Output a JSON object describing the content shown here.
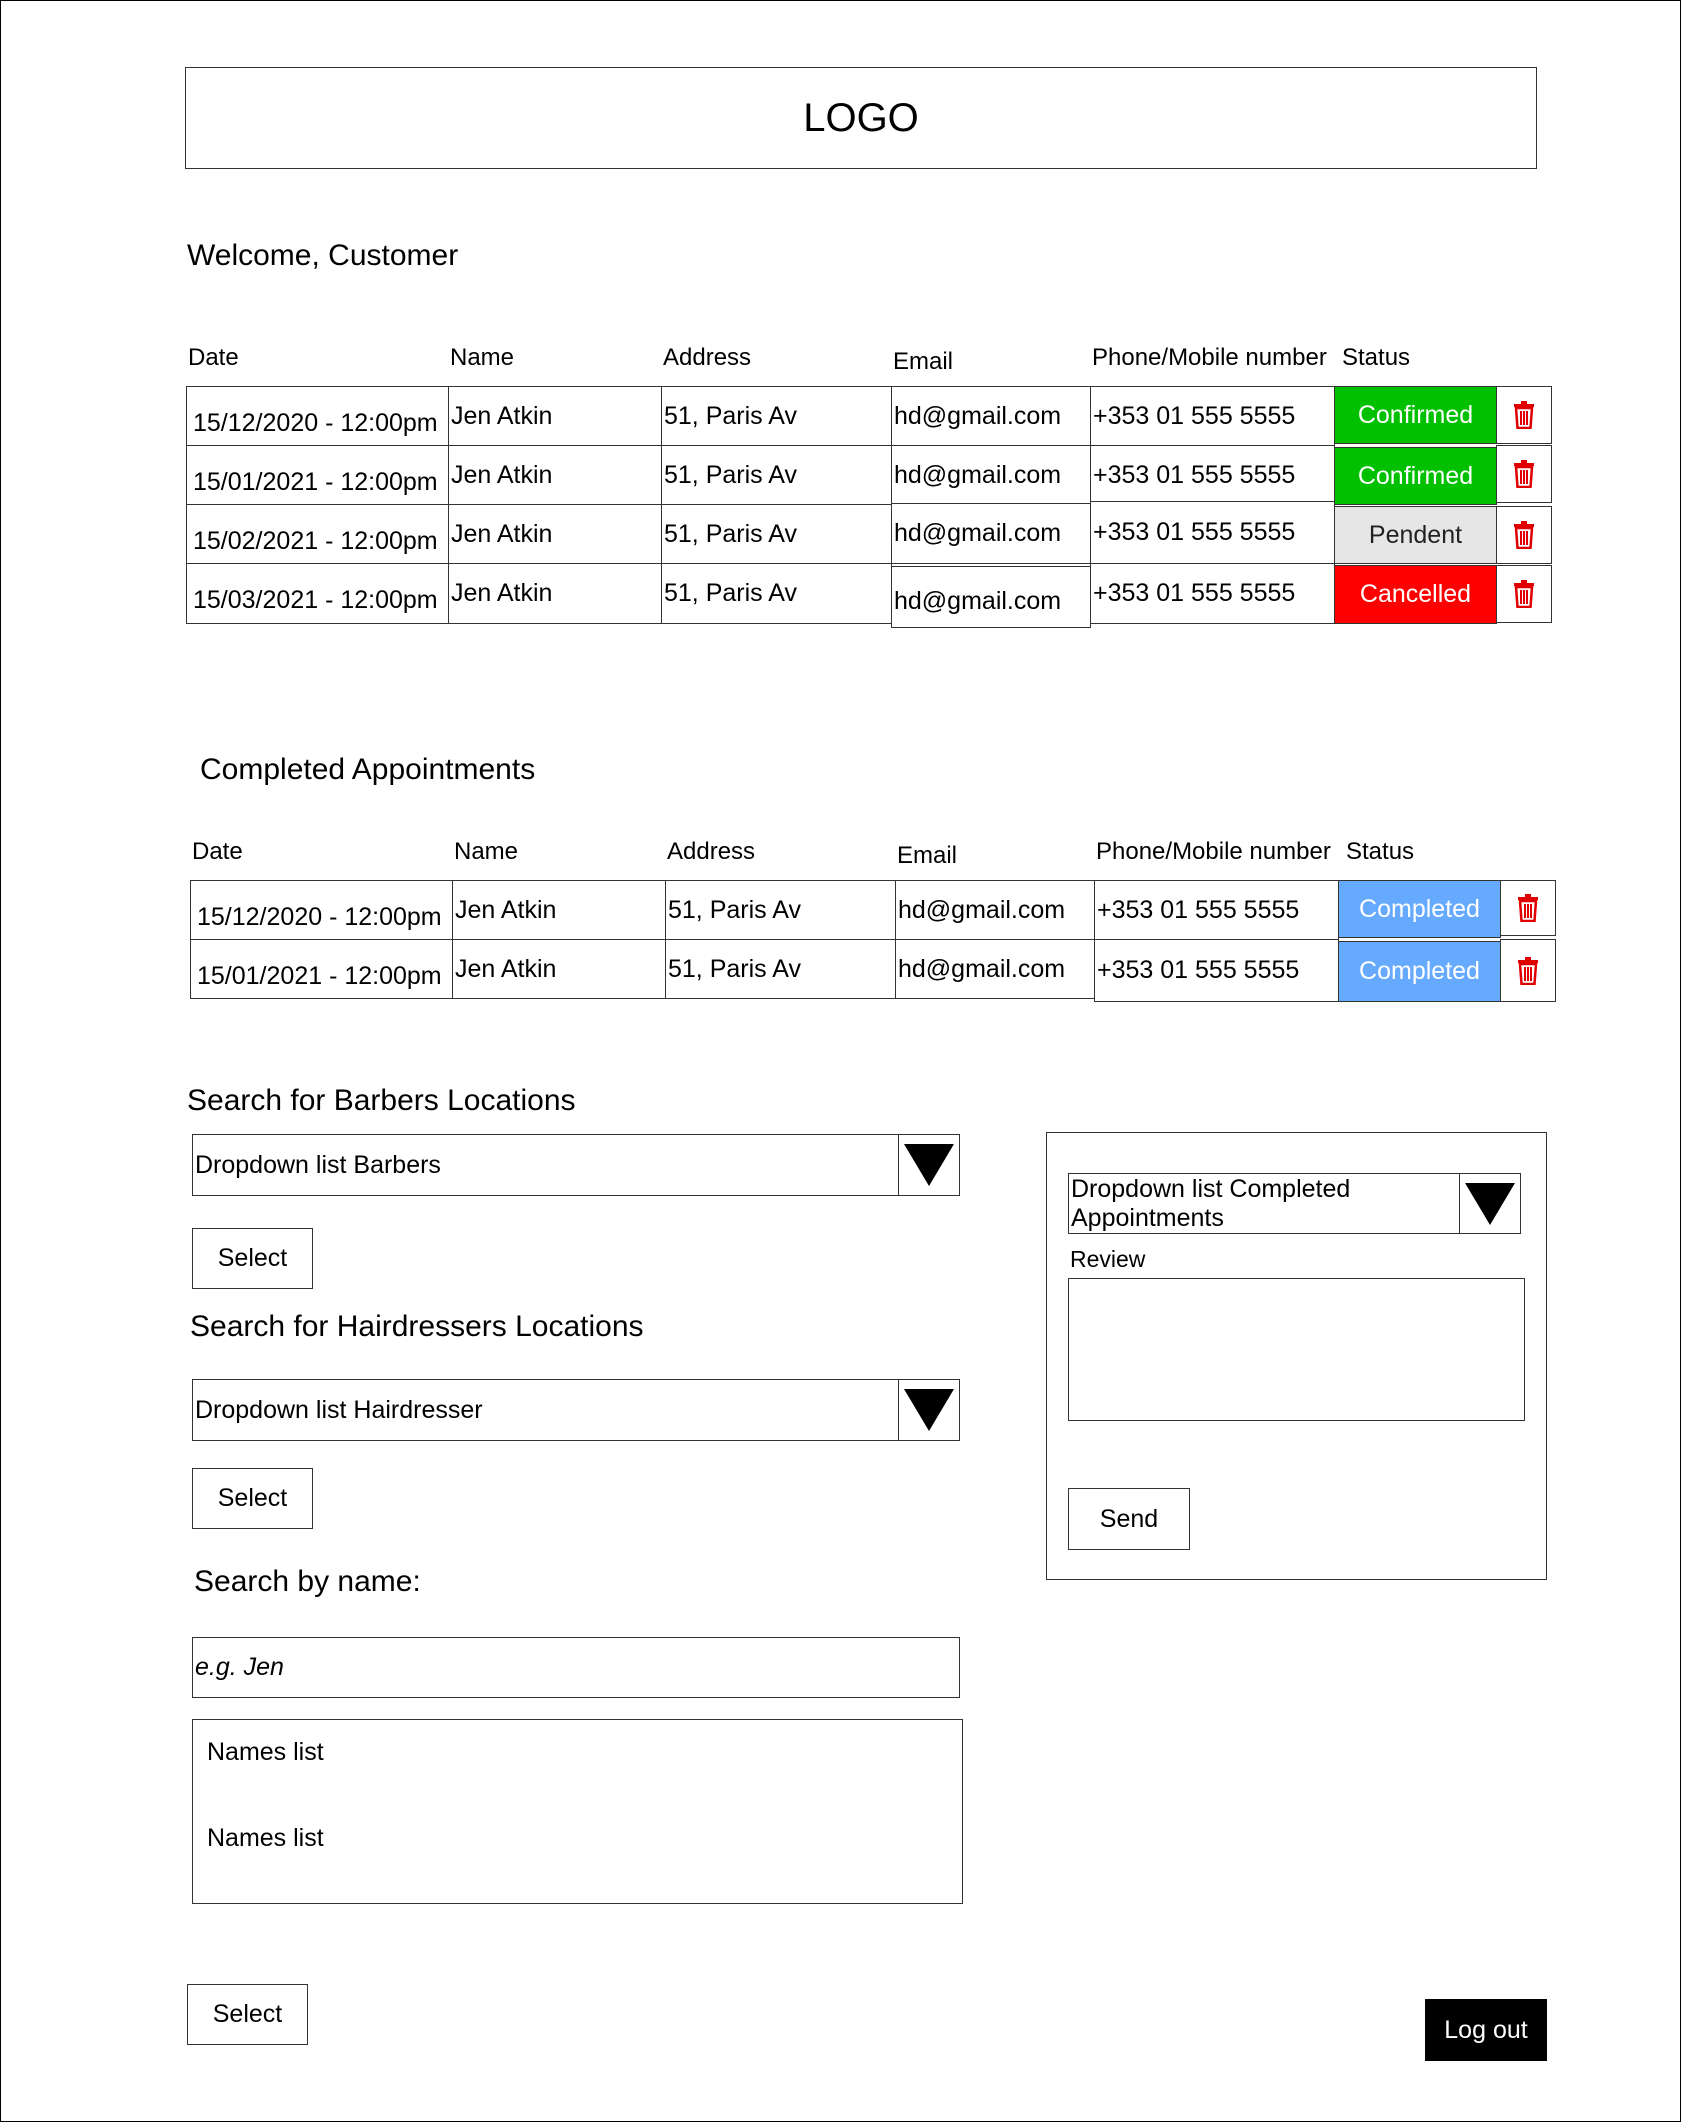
{
  "logo": "LOGO",
  "welcome": "Welcome, Customer",
  "columns": {
    "date": "Date",
    "name": "Name",
    "address": "Address",
    "email": "Email",
    "phone": "Phone/Mobile number",
    "status": "Status"
  },
  "appointments": [
    {
      "date": "15/12/2020 - 12:00pm",
      "name": "Jen Atkin",
      "address": "51, Paris Av",
      "email": "hd@gmail.com",
      "phone": "+353 01 555 5555",
      "status": "Confirmed"
    },
    {
      "date": "15/01/2021 - 12:00pm",
      "name": "Jen Atkin",
      "address": "51, Paris Av",
      "email": "hd@gmail.com",
      "phone": "+353 01 555 5555",
      "status": "Confirmed"
    },
    {
      "date": "15/02/2021 - 12:00pm",
      "name": "Jen Atkin",
      "address": "51, Paris Av",
      "email": "hd@gmail.com",
      "phone": "+353 01 555 5555",
      "status": "Pendent"
    },
    {
      "date": "15/03/2021 - 12:00pm",
      "name": "Jen Atkin",
      "address": "51, Paris Av",
      "email": "hd@gmail.com",
      "phone": "+353 01 555 5555",
      "status": "Cancelled"
    }
  ],
  "completed_title": "Completed Appointments",
  "completed": [
    {
      "date": "15/12/2020 - 12:00pm",
      "name": "Jen Atkin",
      "address": "51, Paris Av",
      "email": "hd@gmail.com",
      "phone": "+353 01 555 5555",
      "status": "Completed"
    },
    {
      "date": "15/01/2021 - 12:00pm",
      "name": "Jen Atkin",
      "address": "51, Paris Av",
      "email": "hd@gmail.com",
      "phone": "+353 01 555 5555",
      "status": "Completed"
    }
  ],
  "barbers": {
    "title": "Search for Barbers Locations",
    "dropdown": "Dropdown list Barbers",
    "select": "Select"
  },
  "hairdressers": {
    "title": "Search for Hairdressers Locations",
    "dropdown": "Dropdown list Hairdresser",
    "select": "Select"
  },
  "name_search": {
    "title": "Search by name:",
    "placeholder": "e.g. Jen",
    "list": [
      "Names list",
      "Names list"
    ],
    "select": "Select"
  },
  "review": {
    "dropdown_line1": "Dropdown list Completed",
    "dropdown_line2": "Appointments",
    "label": "Review",
    "send": "Send"
  },
  "logout": "Log out",
  "colors": {
    "confirmed": "#00c000",
    "pendent": "#e6e6e6",
    "cancelled": "#ff0000",
    "completed": "#66aaff",
    "trash": "#e00000"
  },
  "icons": {
    "delete": "trash-icon",
    "dropdown": "triangle-down-icon"
  }
}
